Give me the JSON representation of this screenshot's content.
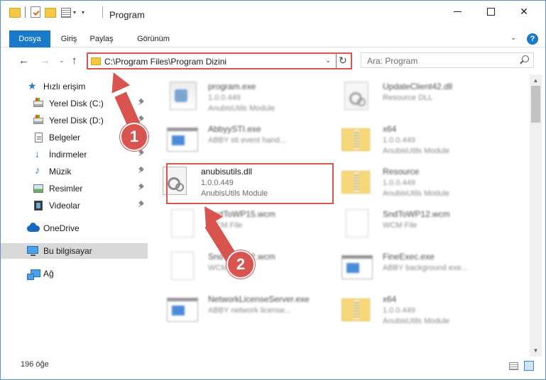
{
  "window": {
    "title": "Program",
    "minimize_label": "minimize",
    "maximize_label": "maximize",
    "close_glyph": "✕"
  },
  "ribbon": {
    "tabs": [
      {
        "label": "Dosya",
        "active": true
      },
      {
        "label": "Giriş"
      },
      {
        "label": "Paylaş"
      },
      {
        "label": "Görünüm"
      }
    ],
    "expand_glyph": "⌄",
    "help_glyph": "?"
  },
  "nav": {
    "back_glyph": "←",
    "forward_glyph": "→",
    "recent_glyph": "⌄",
    "up_glyph": "↑",
    "address": "C:\\Program Files\\Program Dizini",
    "address_drop_glyph": "⌄",
    "refresh_glyph": "↻",
    "search_placeholder": "Ara: Program"
  },
  "sidebar": {
    "items": [
      {
        "label": "Hızlı erişim",
        "icon": "star-icon"
      },
      {
        "label": "Yerel Disk (C:)",
        "icon": "drive-icon",
        "pinned": true
      },
      {
        "label": "Yerel Disk (D:)",
        "icon": "drive-icon",
        "pinned": true
      },
      {
        "label": "Belgeler",
        "icon": "document-icon",
        "pinned": true
      },
      {
        "label": "İndirmeler",
        "icon": "download-icon",
        "pinned": true
      },
      {
        "label": "Müzik",
        "icon": "music-icon",
        "pinned": true
      },
      {
        "label": "Resimler",
        "icon": "pictures-icon",
        "pinned": true
      },
      {
        "label": "Videolar",
        "icon": "video-icon",
        "pinned": true
      },
      {
        "label": "OneDrive",
        "icon": "onedrive-icon"
      },
      {
        "label": "Bu bilgisayar",
        "icon": "computer-icon",
        "selected": true
      },
      {
        "label": "Ağ",
        "icon": "network-icon"
      }
    ]
  },
  "files": [
    {
      "name": "program.exe",
      "version": "1.0.0.449",
      "desc": "AnubisUtils Module",
      "icon": "program-icon",
      "blurred": true
    },
    {
      "name": "UpdateClient42.dll",
      "version": "Resource DLL",
      "desc": "",
      "icon": "gear-file-icon",
      "blurred": true
    },
    {
      "name": "AbbyySTI.exe",
      "version": "ABBY sti event hand...",
      "desc": "",
      "icon": "exe-icon",
      "blurred": true
    },
    {
      "name": "x64",
      "version": "1.0.0.449",
      "desc": "AnubisUtils Module",
      "icon": "zip-folder-icon",
      "blurred": true
    },
    {
      "name": "anubisutils.dll",
      "version": "1.0.0.449",
      "desc": "AnubisUtils Module",
      "icon": "gear-file-icon",
      "blurred": false
    },
    {
      "name": "Resource",
      "version": "1.0.0.449",
      "desc": "AnubisUtils Module",
      "icon": "zip-folder-icon",
      "blurred": true
    },
    {
      "name": "SndToWP15.wcm",
      "version": "WCM File",
      "desc": "",
      "icon": "blank-file-icon",
      "blurred": true
    },
    {
      "name": "SndToWP12.wcm",
      "version": "WCM File",
      "desc": "",
      "icon": "blank-file-icon",
      "blurred": true
    },
    {
      "name": "SndToWP12.wcm",
      "version": "WCM File",
      "desc": "",
      "icon": "blank-file-icon",
      "blurred": true
    },
    {
      "name": "FineExec.exe",
      "version": "ABBY background exe...",
      "desc": "",
      "icon": "exe-icon",
      "blurred": true
    },
    {
      "name": "NetworkLicenseServer.exe",
      "version": "ABBY network license...",
      "desc": "",
      "icon": "exe-icon",
      "blurred": true
    },
    {
      "name": "x64",
      "version": "1.0.0.449",
      "desc": "AnubisUtils Module",
      "icon": "zip-folder-icon",
      "blurred": true
    }
  ],
  "status": {
    "count": "196 öğe"
  },
  "annotations": {
    "step1": "1",
    "step2": "2",
    "color": "#d9534f"
  },
  "colors": {
    "accent": "#1979ca",
    "highlight": "#d9534f",
    "folder": "#f4c842"
  }
}
